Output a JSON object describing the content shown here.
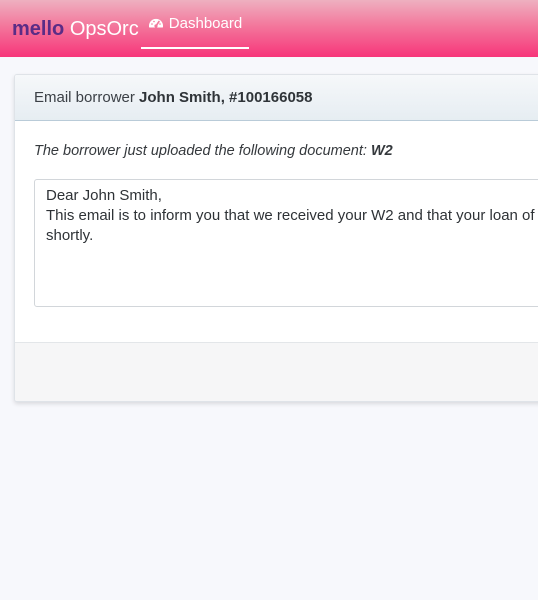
{
  "navbar": {
    "brand_strong": "mello",
    "brand_rest": "OpsOrc",
    "tab_dashboard": "Dashboard",
    "tab_icon": "dashboard-gauge-icon"
  },
  "panel": {
    "header_prefix": "Email borrower",
    "borrower_name": "John Smith, #100166058",
    "intro_text": "The borrower just uploaded the following document:",
    "document_name": "W2",
    "email_body": "Dear John Smith,\nThis email is to inform you that we received your W2 and that your loan of\nshortly."
  },
  "colors": {
    "brand_purple": "#5b2c86",
    "navbar_pink": "#f7357a"
  }
}
